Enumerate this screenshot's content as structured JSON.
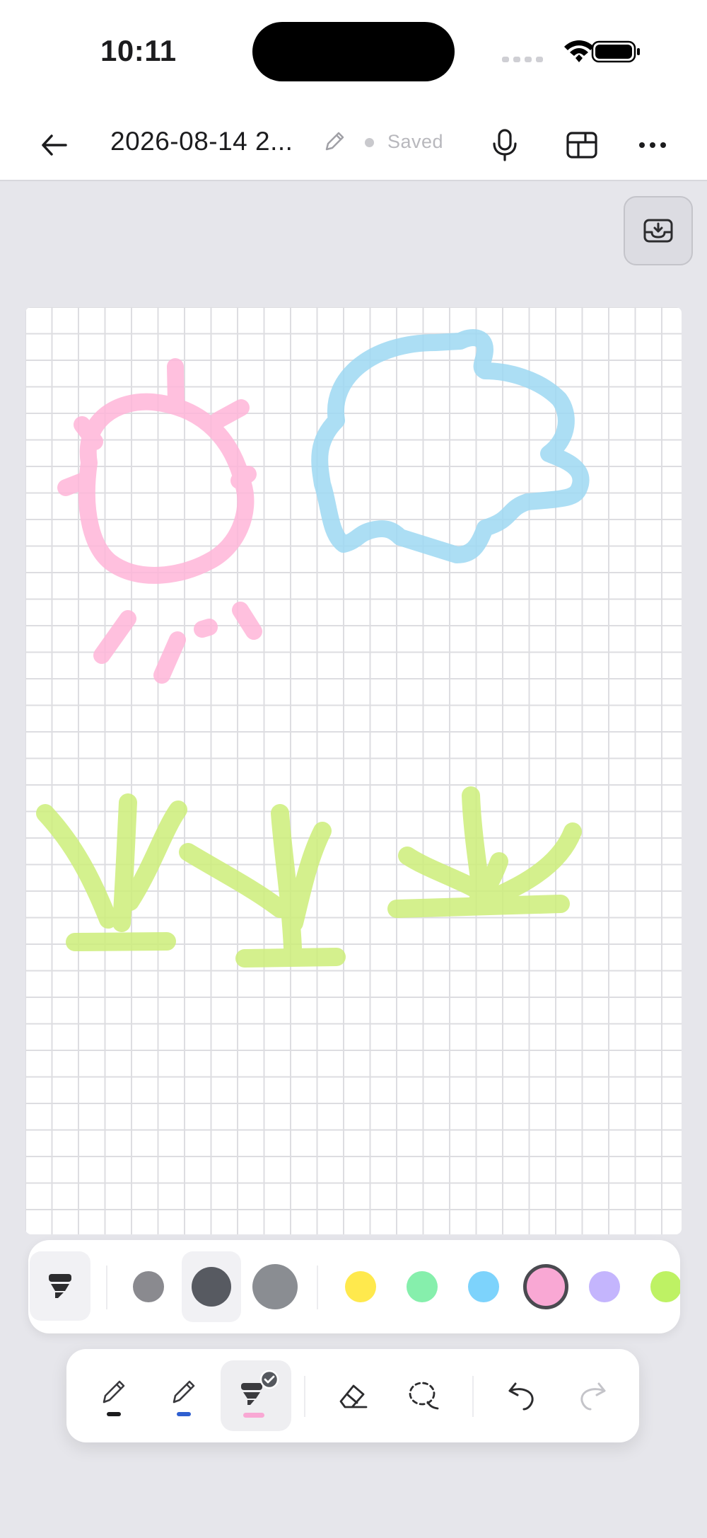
{
  "status_bar": {
    "time": "10:11"
  },
  "header": {
    "title": "2026-08-14 2...",
    "save_status": "Saved",
    "icons": [
      "back-arrow-icon",
      "pencil-edit-icon",
      "microphone-icon",
      "layout-icon",
      "more-horizontal-icon"
    ]
  },
  "fab": {
    "icon": "inbox-download-icon"
  },
  "canvas": {
    "background": "grid",
    "strokes": [
      {
        "shape": "sun",
        "color": "#ffb6d9"
      },
      {
        "shape": "cloud",
        "color": "#9ed8f2"
      },
      {
        "shape": "grass",
        "color": "#cdee7a"
      },
      {
        "shape": "grass",
        "color": "#cdee7a"
      },
      {
        "shape": "grass",
        "color": "#cdee7a"
      }
    ]
  },
  "style_bar": {
    "active_tool_icon": "highlighter-icon",
    "sizes": [
      "small",
      "medium",
      "large"
    ],
    "selected_size": "medium",
    "colors": [
      "#ffe94d",
      "#86efac",
      "#7dd3fc",
      "#f9a8d4",
      "#c4b5fd",
      "#bef264"
    ],
    "selected_color": "#f9a8d4"
  },
  "toolbar": {
    "tools": [
      {
        "name": "pen",
        "accent": "#1c1c1e"
      },
      {
        "name": "pen",
        "accent": "#2f5fd0"
      },
      {
        "name": "highlighter",
        "accent": "#f9a8d4",
        "selected": true
      },
      {
        "name": "eraser"
      },
      {
        "name": "lasso"
      }
    ],
    "actions": [
      "undo",
      "redo"
    ]
  }
}
